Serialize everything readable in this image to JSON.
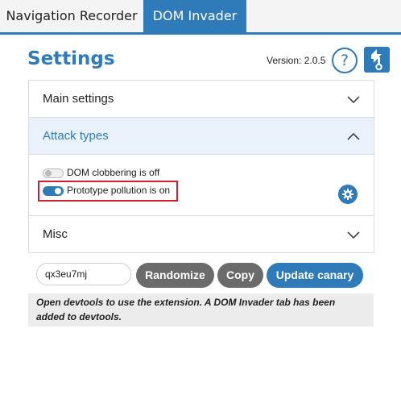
{
  "tabs": [
    {
      "label": "Navigation Recorder",
      "active": false
    },
    {
      "label": "DOM Invader",
      "active": true
    }
  ],
  "header": {
    "title": "Settings",
    "version": "Version: 2.0.5",
    "help_label": "?",
    "logo_icon": "dom-invader-logo-icon"
  },
  "accordion": {
    "main_settings": {
      "label": "Main settings",
      "expanded": false
    },
    "attack_types": {
      "label": "Attack types",
      "expanded": true,
      "options": [
        {
          "label": "DOM clobbering is off",
          "enabled": false
        },
        {
          "label": "Prototype pollution is on",
          "enabled": true
        }
      ]
    },
    "misc": {
      "label": "Misc",
      "expanded": false
    }
  },
  "canary": {
    "value": "qx3eu7mj",
    "randomize_label": "Randomize",
    "copy_label": "Copy",
    "update_label": "Update canary"
  },
  "notice": "Open devtools to use the extension. A DOM Invader tab has been added to devtools.",
  "colors": {
    "accent": "#2f7ab8",
    "secondary_button": "#6b6b6b",
    "highlight": "#d32030"
  }
}
